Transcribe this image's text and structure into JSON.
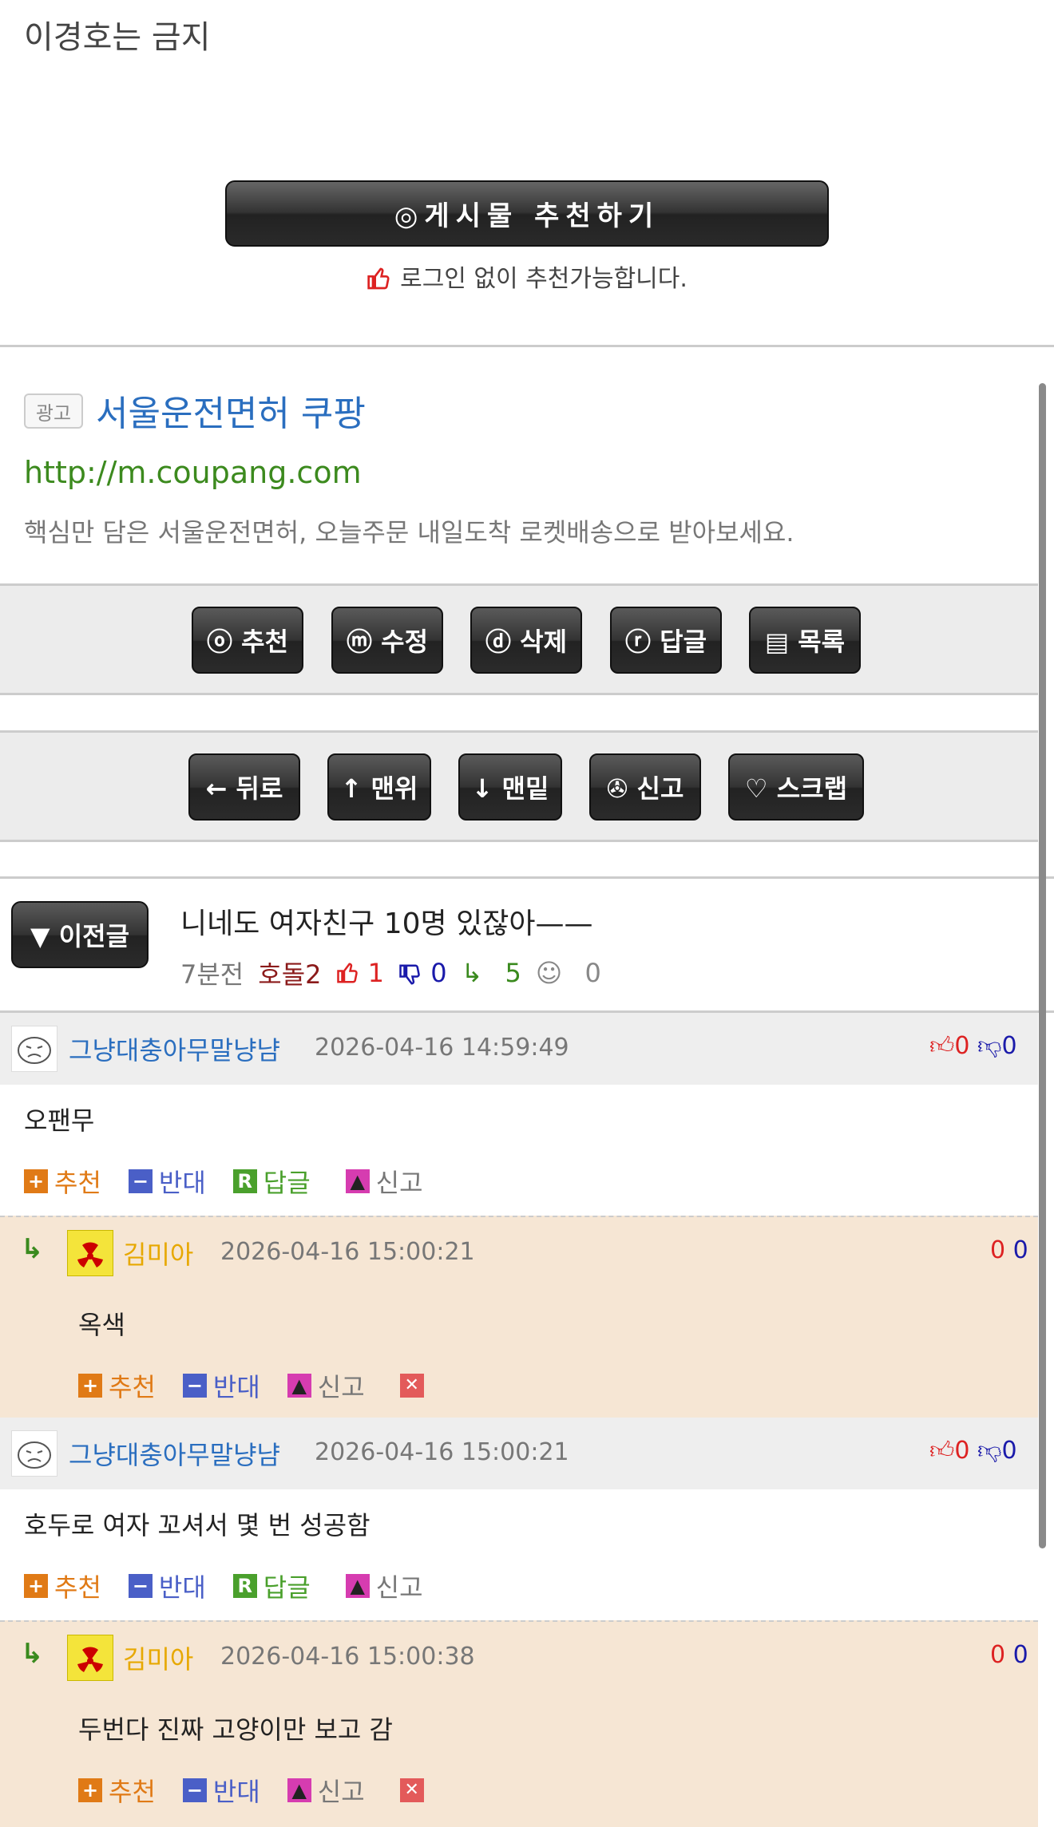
{
  "post": {
    "title_fragment": "이경호는 금지"
  },
  "recommend": {
    "button_label": "◎게시물 추천하기",
    "note": "로그인 없이 추천가능합니다."
  },
  "ad": {
    "badge": "광고",
    "title": "서울운전면허 쿠팡",
    "url": "http://m.coupang.com",
    "desc": "핵심만 담은 서울운전면허, 오늘주문 내일도착 로켓배송으로 받아보세요."
  },
  "actions1": [
    {
      "label": "ⓞ 추천",
      "name": "recommend-button"
    },
    {
      "label": "ⓜ 수정",
      "name": "edit-button"
    },
    {
      "label": "ⓓ 삭제",
      "name": "delete-button"
    },
    {
      "label": "ⓡ 답글",
      "name": "reply-button"
    },
    {
      "label": "▤ 목록",
      "name": "list-button"
    }
  ],
  "actions2": [
    {
      "label": "← 뒤로",
      "name": "back-button"
    },
    {
      "label": "↑ 맨위",
      "name": "top-button"
    },
    {
      "label": "↓ 맨밑",
      "name": "bottom-button"
    },
    {
      "label": "✇ 신고",
      "name": "report-button"
    },
    {
      "label": "♡ 스크랩",
      "name": "scrap-button"
    }
  ],
  "prev_post": {
    "button_label": "▼ 이전글",
    "title": "니네도 여자친구 10명 있잖아——",
    "time": "7분전",
    "author": "호돌2",
    "up": "1",
    "down": "0",
    "replies": "5",
    "views": "0"
  },
  "comments": [
    {
      "nick": "그냥대충아무말냥냠",
      "date": "2026-04-16 14:59:49",
      "up": "0",
      "down": "0",
      "text": "오팬무",
      "reply": {
        "nick": "김미아",
        "date": "2026-04-16 15:00:21",
        "up": "0",
        "down": "0",
        "text": "옥색"
      }
    },
    {
      "nick": "그냥대충아무말냥냠",
      "date": "2026-04-16 15:00:21",
      "up": "0",
      "down": "0",
      "text": "호두로 여자 꼬셔서 몇 번 성공함",
      "reply": {
        "nick": "김미아",
        "date": "2026-04-16 15:00:38",
        "up": "0",
        "down": "0",
        "text": "두번다 진짜 고양이만 보고 감"
      }
    }
  ],
  "labels": {
    "recommend": "추천",
    "oppose": "반대",
    "reply": "답글",
    "report": "신고"
  },
  "colors": {
    "accent_blue": "#2a6ebf",
    "reply_bg": "#f6e6d4",
    "url_green": "#3c8a1e"
  }
}
